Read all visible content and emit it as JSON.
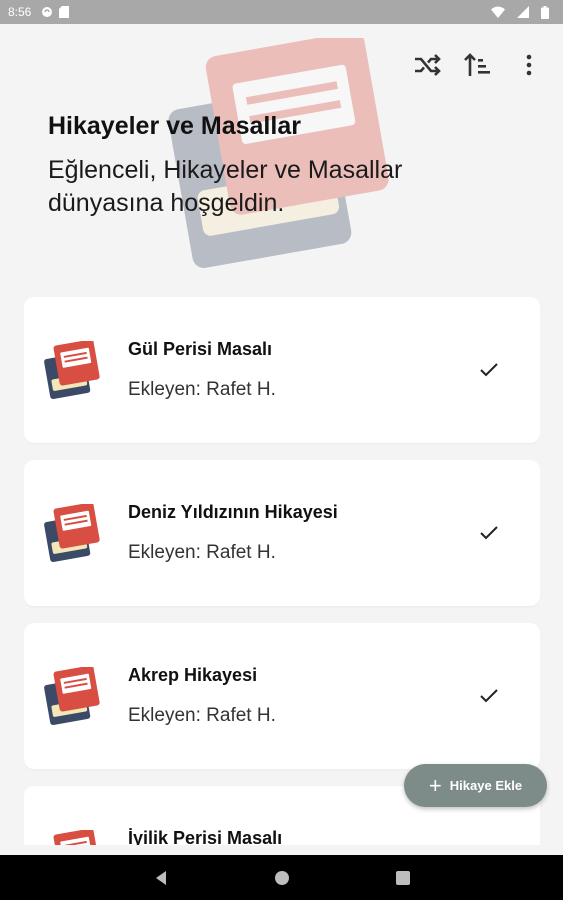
{
  "status_bar": {
    "time": "8:56",
    "left_icons": [
      "sync-icon",
      "sd-card-icon"
    ],
    "right_icons": [
      "wifi-icon",
      "signal-icon",
      "battery-icon"
    ]
  },
  "toolbar": {
    "icons": [
      "shuffle-icon",
      "sort-icon",
      "more-vert-icon"
    ]
  },
  "header": {
    "title": "Hikayeler ve Masallar",
    "subtitle": "Eğlenceli, Hikayeler ve Masallar dünyasına hoşgeldin."
  },
  "stories": [
    {
      "title": "Gül Perisi Masalı",
      "author": "Ekleyen: Rafet H.",
      "icon": "book-icon",
      "status_icon": "check-icon"
    },
    {
      "title": "Deniz Yıldızının Hikayesi",
      "author": "Ekleyen: Rafet H.",
      "icon": "book-icon",
      "status_icon": "check-icon"
    },
    {
      "title": "Akrep Hikayesi",
      "author": "Ekleyen: Rafet H.",
      "icon": "book-icon",
      "status_icon": "check-icon"
    },
    {
      "title": "İyilik Perisi Masalı",
      "author": "",
      "icon": "book-icon",
      "status_icon": ""
    }
  ],
  "fab": {
    "label": "Hikaye Ekle",
    "icon": "plus-icon"
  },
  "nav_bar": {
    "buttons": [
      "back-icon",
      "home-icon",
      "recents-icon"
    ]
  },
  "colors": {
    "background": "#f4f4f4",
    "card": "#ffffff",
    "status_bar": "#a8a8a8",
    "fab": "#7e8c89",
    "book_red": "#d94e43",
    "book_navy": "#3b4a66",
    "book_pages": "#f5e6b8"
  }
}
